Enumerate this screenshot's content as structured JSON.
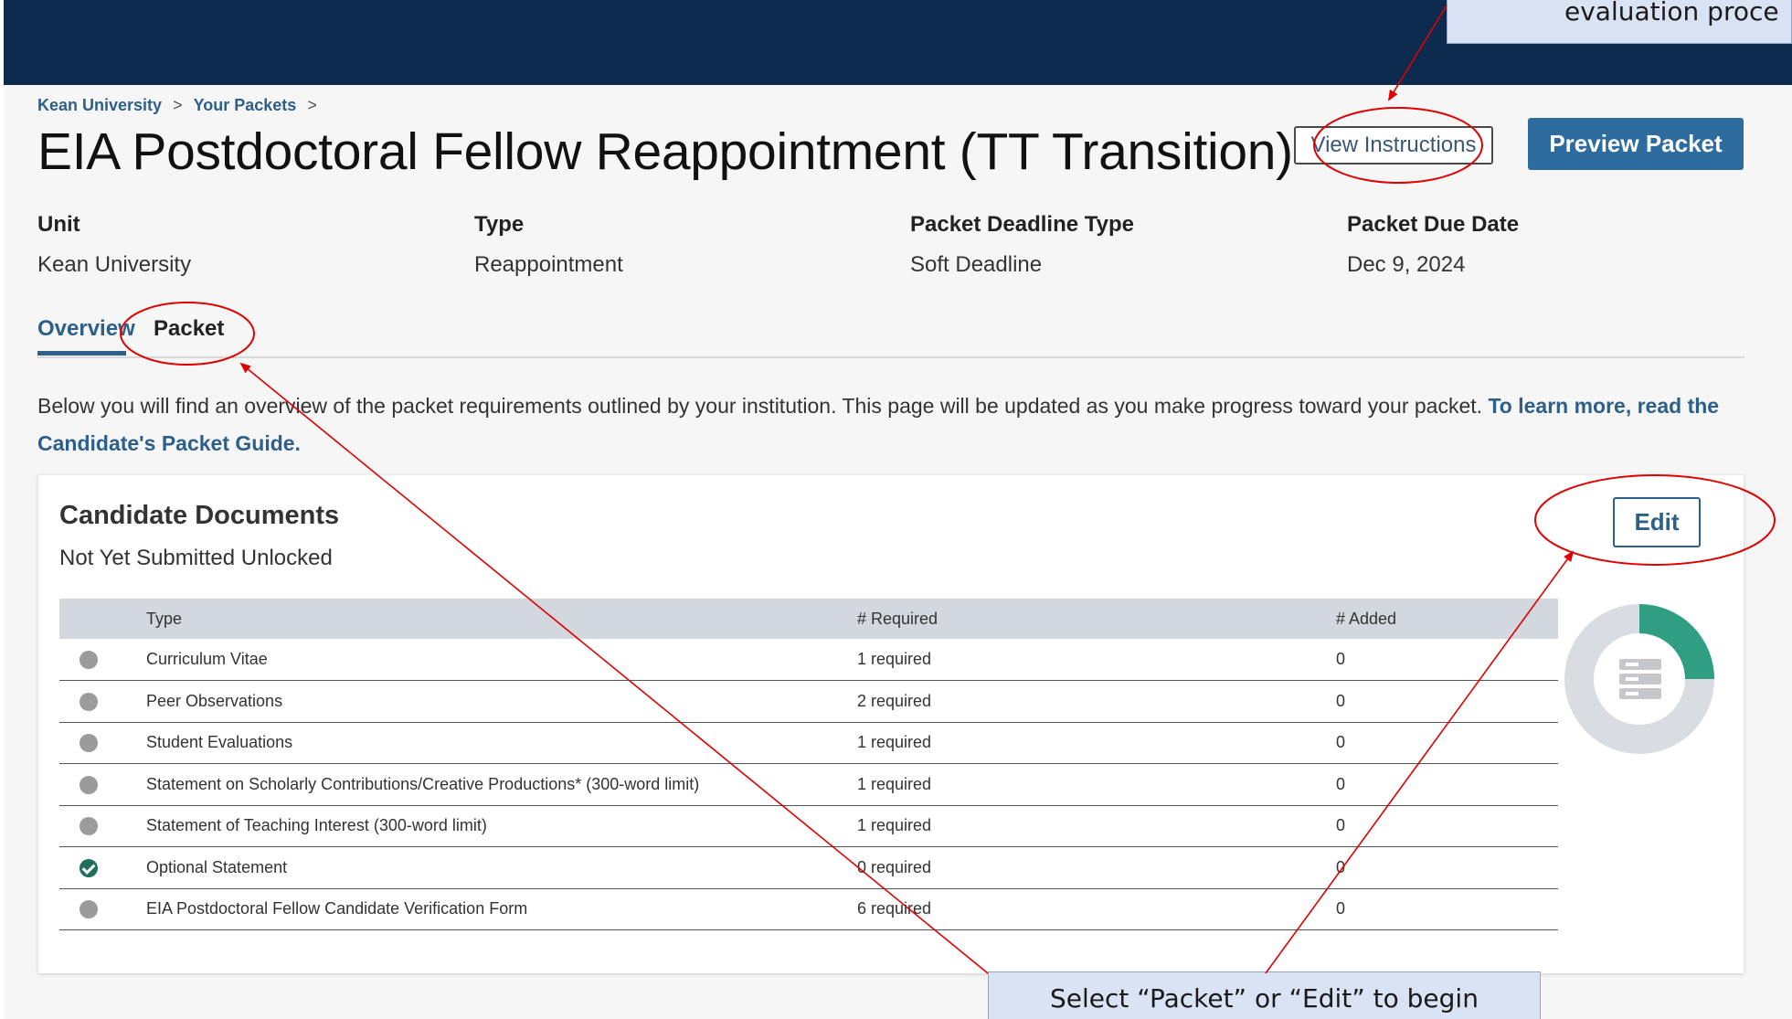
{
  "callouts": {
    "top": "evaluation proce",
    "bottom": "Select “Packet” or “Edit” to begin"
  },
  "breadcrumb": {
    "items": [
      "Kean University",
      "Your Packets"
    ],
    "separator": ">"
  },
  "header": {
    "title": "EIA Postdoctoral Fellow Reappointment (TT Transition)",
    "view_instructions": "View Instructions",
    "preview_packet": "Preview Packet"
  },
  "meta": [
    {
      "label": "Unit",
      "value": "Kean University"
    },
    {
      "label": "Type",
      "value": "Reappointment"
    },
    {
      "label": "Packet Deadline Type",
      "value": "Soft Deadline"
    },
    {
      "label": "Packet Due Date",
      "value": "Dec 9, 2024"
    }
  ],
  "tabs": {
    "overview": "Overview",
    "packet": "Packet"
  },
  "intro": {
    "text": "Below you will find an overview of the packet requirements outlined by your institution. This page will be updated as you make progress toward your packet. ",
    "link": "To learn more, read the Candidate's Packet Guide."
  },
  "card": {
    "title": "Candidate Documents",
    "subtitle": "Not Yet Submitted Unlocked",
    "edit": "Edit",
    "columns": [
      "Type",
      "# Required",
      "# Added"
    ],
    "rows": [
      {
        "status": "pending",
        "type": "Curriculum Vitae",
        "required": "1 required",
        "added": "0"
      },
      {
        "status": "pending",
        "type": "Peer Observations",
        "required": "2 required",
        "added": "0"
      },
      {
        "status": "pending",
        "type": "Student Evaluations",
        "required": "1 required",
        "added": "0"
      },
      {
        "status": "pending",
        "type": "Statement on Scholarly Contributions/Creative Productions* (300-word limit)",
        "required": "1 required",
        "added": "0"
      },
      {
        "status": "pending",
        "type": "Statement of Teaching Interest (300-word limit)",
        "required": "1 required",
        "added": "0"
      },
      {
        "status": "complete",
        "type": "Optional Statement",
        "required": "0 required",
        "added": "0"
      },
      {
        "status": "pending",
        "type": "EIA Postdoctoral Fellow Candidate Verification Form",
        "required": "6 required",
        "added": "0"
      }
    ],
    "progress_fraction": 0.25
  },
  "colors": {
    "nav": "#0d2b4f",
    "accent": "#2c5f8a",
    "progress": "#2f9e83",
    "annotation": "#e00000"
  }
}
